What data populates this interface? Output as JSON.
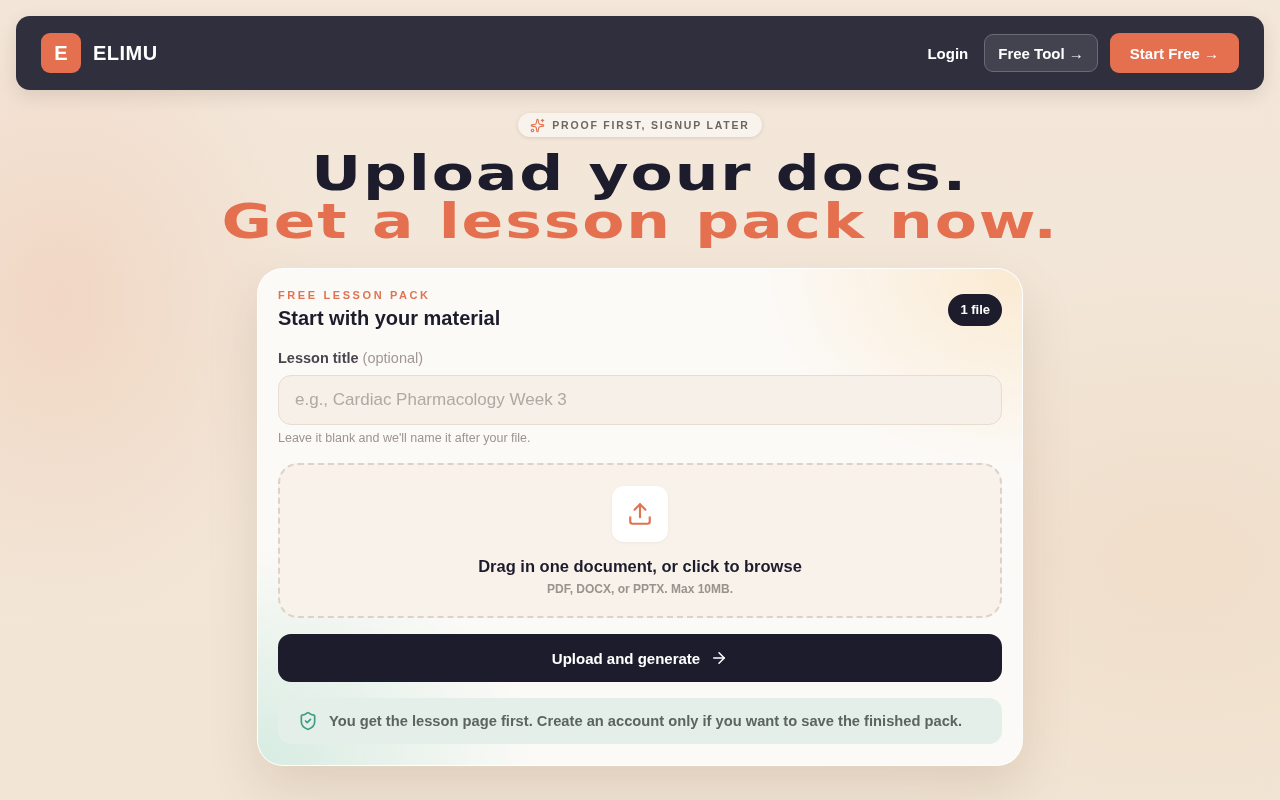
{
  "navbar": {
    "logo_letter": "E",
    "brand": "ELIMU",
    "links": [
      {
        "label": "Login",
        "kind": "link"
      },
      {
        "label": "Free Tool →",
        "kind": "outline"
      },
      {
        "label": "Start Free →",
        "kind": "primary"
      }
    ]
  },
  "hero": {
    "badge": "PROOF FIRST, SIGNUP LATER",
    "headline_line_1": "Upload your docs.",
    "headline_line_2": "Get a lesson pack now."
  },
  "card": {
    "eyebrow": "FREE LESSON PACK",
    "title": "Start with your material",
    "file_count": "1 file",
    "title_field": {
      "label": "**Lesson title** (optional)",
      "placeholder": "e.g., Cardiac Pharmacology Week 3",
      "hint": "Leave it blank and we'll name it after your file."
    },
    "dropzone": {
      "title": "Drag in one document, or click to browse",
      "subtitle": "PDF, DOCX, or PPTX. Max 10MB."
    },
    "submit_button": "Upload and generate",
    "notice": "You get the lesson page first. Create an account only if you want to save the finished pack."
  }
}
